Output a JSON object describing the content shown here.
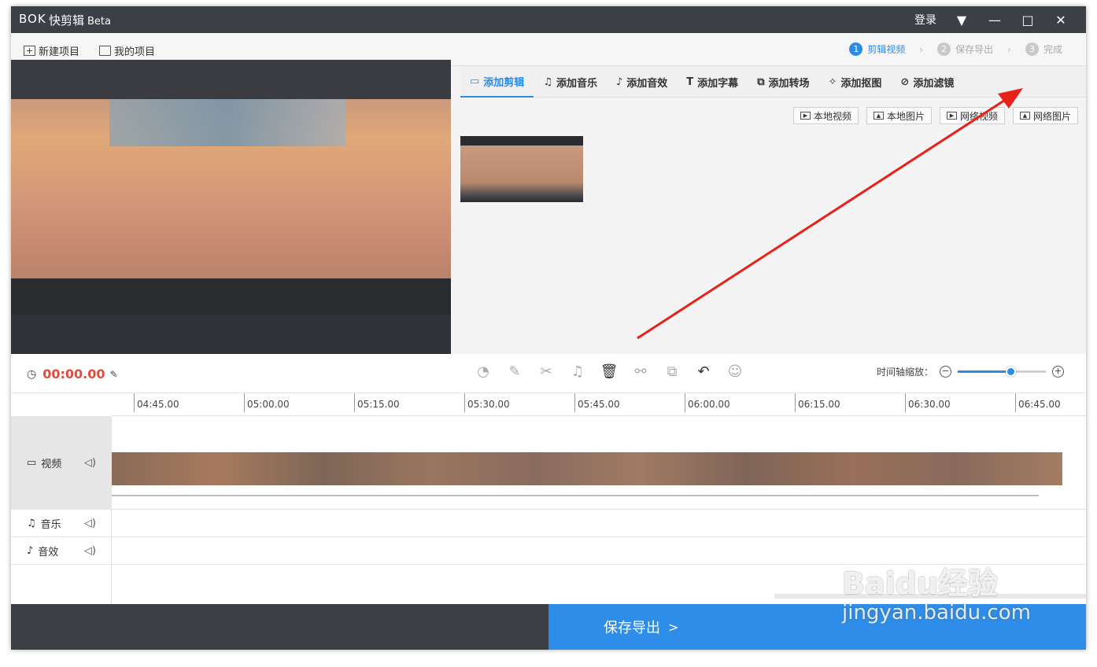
{
  "app": {
    "logo_text": "BOK",
    "name": "快剪辑",
    "beta": "Beta",
    "login": "登录",
    "controls": {
      "menu": "▼",
      "minimize": "—",
      "maximize": "□",
      "close": "✕"
    }
  },
  "toolbar": {
    "new_project": "新建项目",
    "my_projects": "我的项目"
  },
  "steps": [
    {
      "num": "1",
      "label": "剪辑视频"
    },
    {
      "num": "2",
      "label": "保存导出"
    },
    {
      "num": "3",
      "label": "完成"
    }
  ],
  "tabs": [
    {
      "icon": "video-icon",
      "label": "添加剪辑"
    },
    {
      "icon": "music-icon",
      "label": "添加音乐"
    },
    {
      "icon": "sound-effect-icon",
      "label": "添加音效"
    },
    {
      "icon": "text-icon",
      "label": "添加字幕"
    },
    {
      "icon": "transition-icon",
      "label": "添加转场"
    },
    {
      "icon": "cutout-icon",
      "label": "添加抠图"
    },
    {
      "icon": "filter-icon",
      "label": "添加滤镜"
    }
  ],
  "source_buttons": [
    "本地视频",
    "本地图片",
    "网络视频",
    "网络图片"
  ],
  "editbar": {
    "timecode": "00:00.00",
    "zoom_label": "时间轴缩放：",
    "zoom_level": 0.6
  },
  "ruler_ticks": [
    "04:45.00",
    "05:00.00",
    "05:15.00",
    "05:30.00",
    "05:45.00",
    "06:00.00",
    "06:15.00",
    "06:30.00",
    "06:45.00"
  ],
  "tracks": {
    "video": "视频",
    "music": "音乐",
    "sfx": "音效"
  },
  "export": {
    "label": "保存导出",
    "chevron": ">"
  },
  "watermark": {
    "line1": "Baidu经验",
    "line2": "jingyan.baidu.com"
  },
  "colors": {
    "accent": "#2e8de8",
    "titlebar": "#3c3f45",
    "timecode": "#e24b3b",
    "annotation_arrow": "#e8221a"
  }
}
